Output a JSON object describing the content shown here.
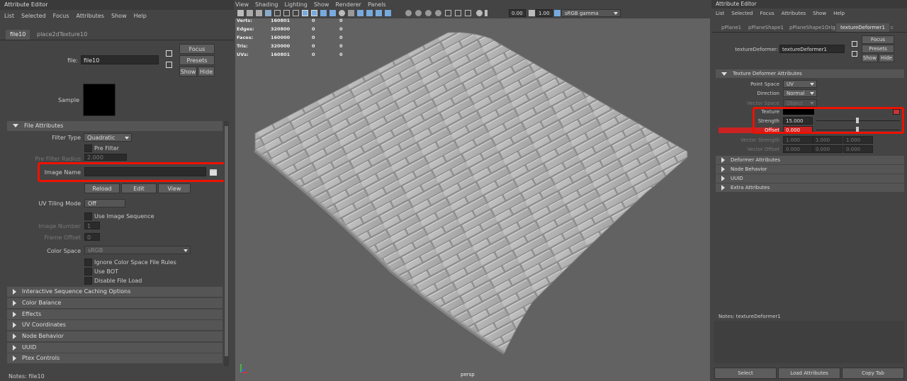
{
  "left_editor": {
    "title": "Attribute Editor",
    "menu": [
      "List",
      "Selected",
      "Focus",
      "Attributes",
      "Show",
      "Help"
    ],
    "tabs": [
      "file10",
      "place2dTexture10"
    ],
    "file_label": "file:",
    "file_value": "file10",
    "focus_label": "Focus",
    "presets_label": "Presets",
    "show_label": "Show",
    "hide_label": "Hide",
    "sample_label": "Sample",
    "file_attributes_header": "File Attributes",
    "filter_type_label": "Filter Type",
    "filter_type_value": "Quadratic",
    "pre_filter_label": "Pre Filter",
    "pre_filter_radius_label": "Pre Filter Radius",
    "pre_filter_radius_value": "2.000",
    "image_name_label": "Image Name",
    "image_name_value": "",
    "reload_label": "Reload",
    "edit_label": "Edit",
    "view_label": "View",
    "uv_tiling_label": "UV Tiling Mode",
    "uv_tiling_value": "Off",
    "use_image_sequence_label": "Use Image Sequence",
    "image_number_label": "Image Number",
    "image_number_value": "1",
    "frame_offset_label": "Frame Offset",
    "frame_offset_value": "0",
    "color_space_label": "Color Space",
    "color_space_value": "sRGB",
    "ignore_rules_label": "Ignore Color Space File Rules",
    "use_bot_label": "Use BOT",
    "disable_file_load_label": "Disable File Load",
    "collapsed_sections": [
      "Interactive Sequence Caching Options",
      "Color Balance",
      "Effects",
      "UV Coordinates",
      "Node Behavior",
      "UUID",
      "Ptex Controls"
    ],
    "notes": "Notes:  file10"
  },
  "viewport": {
    "menu": [
      "View",
      "Shading",
      "Lighting",
      "Show",
      "Renderer",
      "Panels"
    ],
    "exposure": "0.00",
    "gamma": "1.00",
    "color_space": "sRGB gamma",
    "hud_rows": [
      {
        "label": "Verts:",
        "a": "160801",
        "b": "0",
        "c": "0"
      },
      {
        "label": "Edges:",
        "a": "320800",
        "b": "0",
        "c": "0"
      },
      {
        "label": "Faces:",
        "a": "160000",
        "b": "0",
        "c": "0"
      },
      {
        "label": "Tris:",
        "a": "320000",
        "b": "0",
        "c": "0"
      },
      {
        "label": "UVs:",
        "a": "160801",
        "b": "0",
        "c": "0"
      }
    ],
    "camera": "persp"
  },
  "right_editor": {
    "title": "Attribute Editor",
    "menu": [
      "List",
      "Selected",
      "Focus",
      "Attributes",
      "Show",
      "Help"
    ],
    "tabs": [
      "pPlane1",
      "pPlaneShape1",
      "pPlaneShape1Orig",
      "textureDeformer1"
    ],
    "tab_overflow": "c",
    "node_label": "textureDeformer:",
    "node_value": "textureDeformer1",
    "focus_label": "Focus",
    "presets_label": "Presets",
    "show_label": "Show",
    "hide_label": "Hide",
    "section_header": "Texture Deformer Attributes",
    "point_space_label": "Point Space",
    "point_space_value": "UV",
    "direction_label": "Direction",
    "direction_value": "Normal",
    "vector_space_label": "Vector Space",
    "vector_space_value": "Object",
    "texture_label": "Texture",
    "strength_label": "Strength",
    "strength_value": "15.000",
    "offset_label": "Offset",
    "offset_value": "0.000",
    "vector_strength_label": "Vector Strength",
    "vector_strength_values": [
      "1.000",
      "1.000",
      "1.000"
    ],
    "vector_offset_label": "Vector Offset",
    "vector_offset_values": [
      "0.000",
      "0.000",
      "0.000"
    ],
    "collapsed_sections": [
      "Deformer Attributes",
      "Node Behavior",
      "UUID",
      "Extra Attributes"
    ],
    "notes": "Notes:  textureDeformer1",
    "select_label": "Select",
    "load_attributes_label": "Load Attributes",
    "copy_tab_label": "Copy Tab"
  }
}
